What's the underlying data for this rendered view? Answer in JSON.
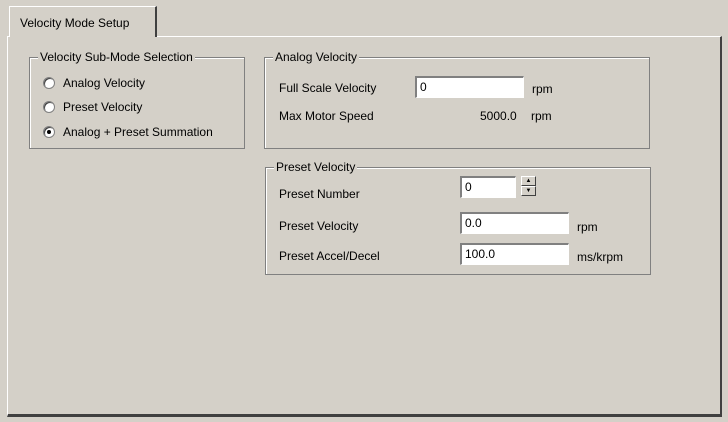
{
  "tab": {
    "label": "Velocity Mode Setup"
  },
  "submode": {
    "title": "Velocity Sub-Mode Selection",
    "options": [
      {
        "label": "Analog Velocity",
        "checked": false
      },
      {
        "label": "Preset Velocity",
        "checked": false
      },
      {
        "label": "Analog + Preset Summation",
        "checked": true
      }
    ]
  },
  "analog": {
    "title": "Analog Velocity",
    "full_scale_label": "Full Scale Velocity",
    "full_scale_value": "0",
    "full_scale_unit": "rpm",
    "max_speed_label": "Max Motor Speed",
    "max_speed_value": "5000.0",
    "max_speed_unit": "rpm"
  },
  "preset": {
    "title": "Preset Velocity",
    "number_label": "Preset Number",
    "number_value": "0",
    "velocity_label": "Preset Velocity",
    "velocity_value": "0.0",
    "velocity_unit": "rpm",
    "accel_label": "Preset Accel/Decel",
    "accel_value": "100.0",
    "accel_unit": "ms/krpm"
  }
}
